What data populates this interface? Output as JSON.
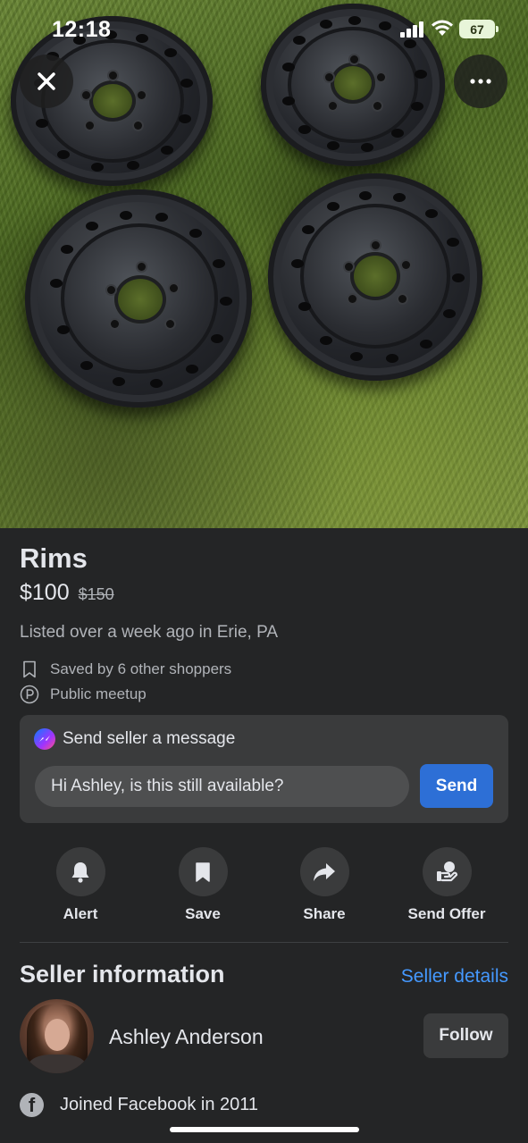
{
  "status_bar": {
    "time": "12:18",
    "battery": "67"
  },
  "photo": {
    "subject": "four black steel rims on grass"
  },
  "listing": {
    "title": "Rims",
    "price": "$100",
    "original_price": "$150",
    "listed": "Listed over a week ago in Erie, PA",
    "saved": "Saved by 6 other shoppers",
    "meetup": "Public meetup"
  },
  "message": {
    "header": "Send seller a message",
    "input_value": "Hi Ashley, is this still available?",
    "send_label": "Send"
  },
  "actions": [
    {
      "label": "Alert",
      "icon": "bell-icon"
    },
    {
      "label": "Save",
      "icon": "bookmark-icon"
    },
    {
      "label": "Share",
      "icon": "share-icon"
    },
    {
      "label": "Send Offer",
      "icon": "send-offer-icon"
    }
  ],
  "seller": {
    "section_title": "Seller information",
    "details_link": "Seller details",
    "name": "Ashley Anderson",
    "follow_label": "Follow",
    "joined": "Joined Facebook in 2011"
  },
  "colors": {
    "background": "#242526",
    "card": "#3a3b3c",
    "accent_button": "#2d6fd6",
    "link": "#4599ff"
  }
}
